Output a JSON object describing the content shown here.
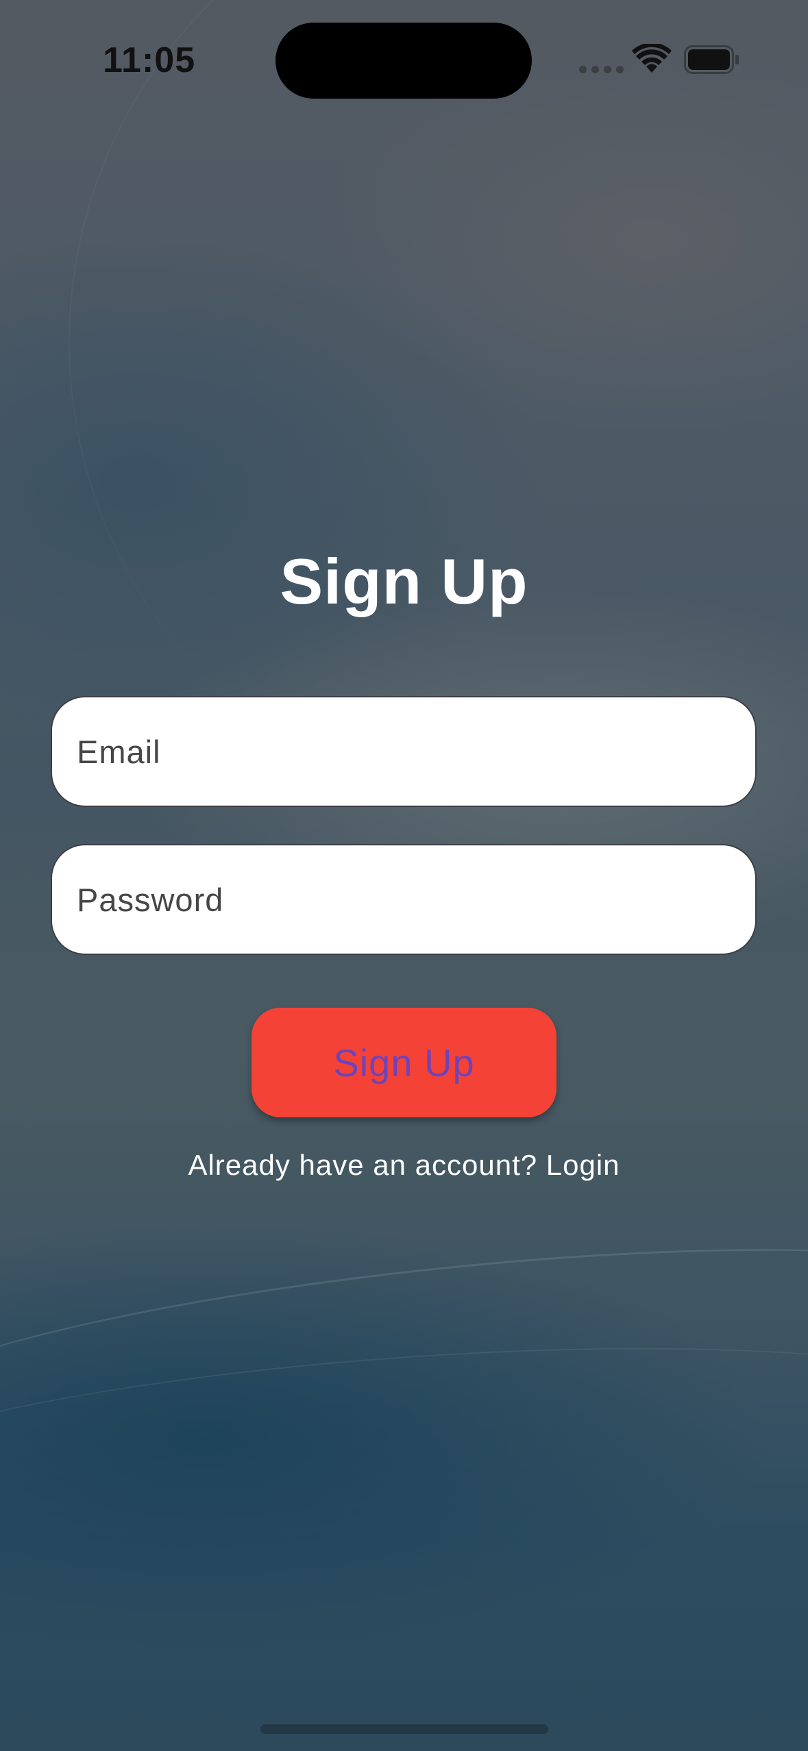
{
  "status_bar": {
    "time": "11:05"
  },
  "form": {
    "title": "Sign Up",
    "email_placeholder": "Email",
    "password_placeholder": "Password",
    "submit_label": "Sign Up",
    "login_prompt": "Already have an account? Login"
  },
  "colors": {
    "button_bg": "#f44336",
    "button_text": "#6f43b8",
    "field_bg": "#ffffff",
    "title_text": "#ffffff"
  }
}
